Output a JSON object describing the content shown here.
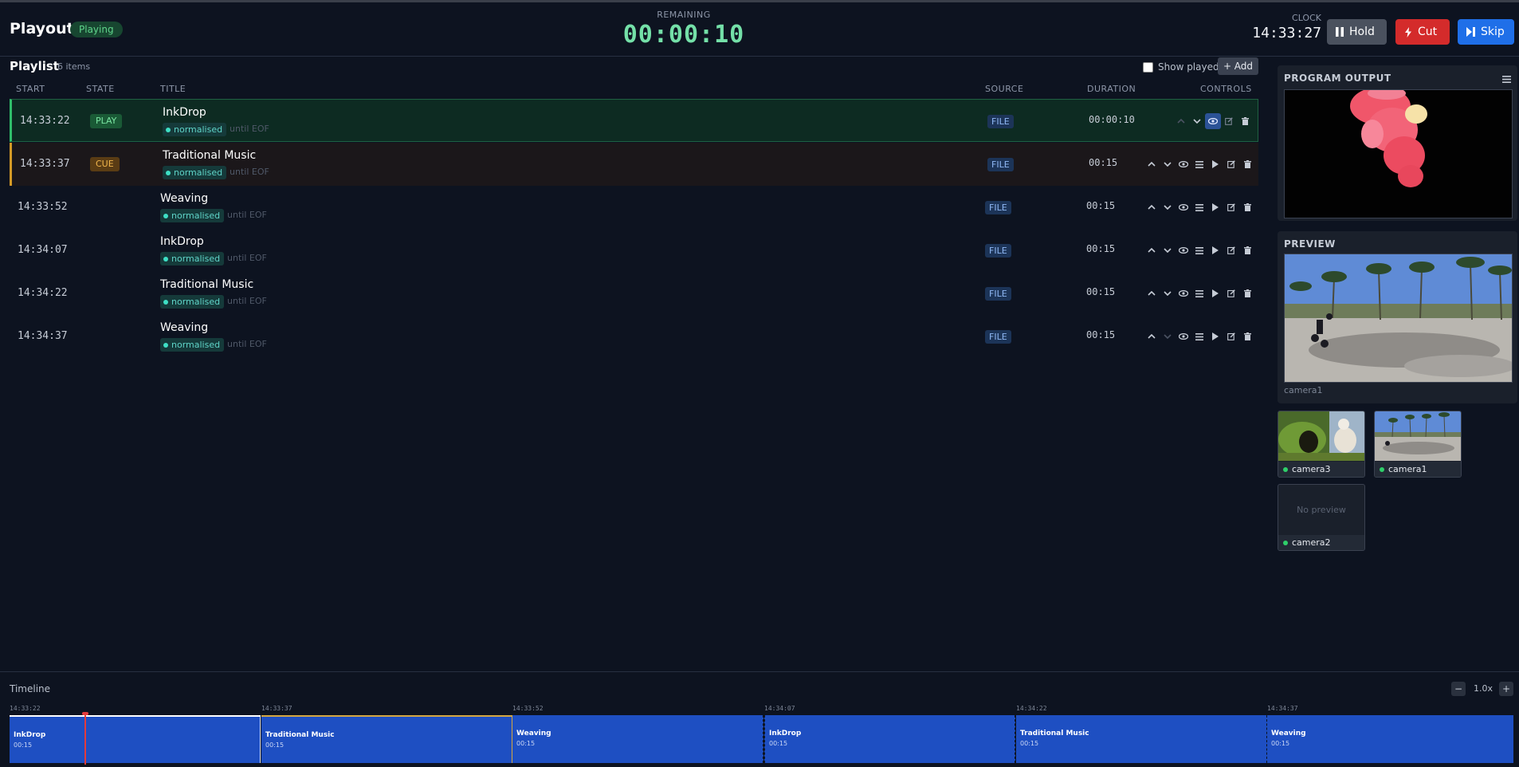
{
  "header": {
    "title": "Playout",
    "status": "Playing",
    "remaining_label": "REMAINING",
    "remaining_value": "00:00:10",
    "clock_label": "CLOCK",
    "clock_value": "14:33:27",
    "hold_label": "Hold",
    "cut_label": "Cut",
    "skip_label": "Skip"
  },
  "playlist": {
    "title": "Playlist",
    "count": "6 items",
    "show_played_label": "Show played",
    "add_label": "+ Add",
    "columns": {
      "start": "START",
      "state": "STATE",
      "title": "TITLE",
      "source": "SOURCE",
      "duration": "DURATION",
      "controls": "CONTROLS"
    },
    "rows": [
      {
        "start": "14:33:22",
        "state": "PLAY",
        "title": "InkDrop",
        "status": "normalised",
        "until": "until EOF",
        "source": "FILE",
        "duration": "00:00:10"
      },
      {
        "start": "14:33:37",
        "state": "CUE",
        "title": "Traditional Music",
        "status": "normalised",
        "until": "until EOF",
        "source": "FILE",
        "duration": "00:15"
      },
      {
        "start": "14:33:52",
        "state": "",
        "title": "Weaving",
        "status": "normalised",
        "until": "until EOF",
        "source": "FILE",
        "duration": "00:15"
      },
      {
        "start": "14:34:07",
        "state": "",
        "title": "InkDrop",
        "status": "normalised",
        "until": "until EOF",
        "source": "FILE",
        "duration": "00:15"
      },
      {
        "start": "14:34:22",
        "state": "",
        "title": "Traditional Music",
        "status": "normalised",
        "until": "until EOF",
        "source": "FILE",
        "duration": "00:15"
      },
      {
        "start": "14:34:37",
        "state": "",
        "title": "Weaving",
        "status": "normalised",
        "until": "until EOF",
        "source": "FILE",
        "duration": "00:15"
      }
    ]
  },
  "program_output": {
    "title": "PROGRAM OUTPUT"
  },
  "preview": {
    "title": "PREVIEW",
    "source": "camera1"
  },
  "sources": [
    {
      "name": "camera3",
      "preview": ""
    },
    {
      "name": "camera1",
      "preview": ""
    },
    {
      "name": "camera2",
      "preview": "No preview"
    }
  ],
  "timeline": {
    "title": "Timeline",
    "zoom_minus": "−",
    "zoom_value": "1.0x",
    "zoom_plus": "+",
    "ticks": [
      "14:33:22",
      "14:33:37",
      "14:33:52",
      "14:34:07",
      "14:34:22",
      "14:34:37"
    ],
    "blocks": [
      {
        "title": "InkDrop",
        "duration": "00:15"
      },
      {
        "title": "Traditional Music",
        "duration": "00:15"
      },
      {
        "title": "Weaving",
        "duration": "00:15"
      },
      {
        "title": "InkDrop",
        "duration": "00:15"
      },
      {
        "title": "Traditional Music",
        "duration": "00:15"
      },
      {
        "title": "Weaving",
        "duration": "00:15"
      }
    ]
  },
  "colors": {
    "background": "#0d1320",
    "playing_accent": "#2fbf6a",
    "cue_accent": "#d49a26",
    "timeline_block": "#1e4fc2",
    "playhead": "#e33b3b"
  }
}
